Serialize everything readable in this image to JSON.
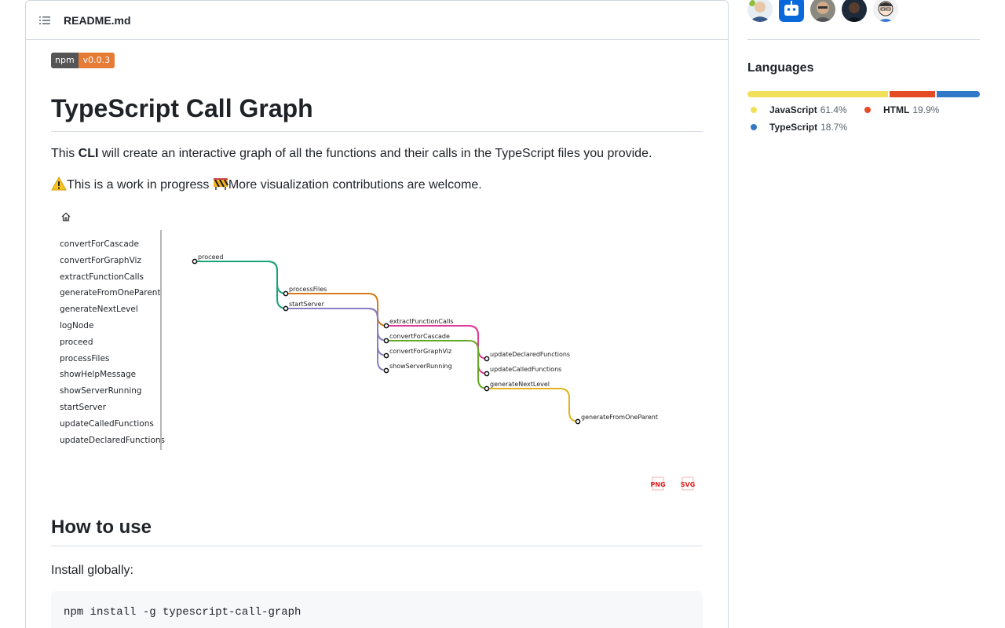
{
  "readme": {
    "filename": "README.md",
    "badge": {
      "label": "npm",
      "version": "v0.0.3",
      "label_color": "#555555",
      "version_color": "#e57b35"
    },
    "title": "TypeScript Call Graph",
    "intro": {
      "before": "This ",
      "bold": "CLI",
      "after": " will create an interactive graph of all the functions and their calls in the TypeScript files you provide."
    },
    "wip": {
      "text1": "This is a work in progress ",
      "text2": "More visualization contributions are welcome."
    },
    "graph": {
      "functions": [
        "convertForCascade",
        "convertForGraphViz",
        "extractFunctionCalls",
        "generateFromOneParent",
        "generateNextLevel",
        "logNode",
        "proceed",
        "processFiles",
        "showHelpMessage",
        "showServerRunning",
        "startServer",
        "updateCalledFunctions",
        "updateDeclaredFunctions"
      ],
      "nodes": [
        "proceed",
        "processFiles",
        "startServer",
        "extractFunctionCalls",
        "convertForCascade",
        "convertForGraphViz",
        "showServerRunning",
        "updateDeclaredFunctions",
        "updateCalledFunctions",
        "generateNextLevel",
        "generateFromOneParent"
      ],
      "edges": [
        {
          "from": "proceed",
          "to": "processFiles",
          "color": "#1aa37a"
        },
        {
          "from": "proceed",
          "to": "startServer",
          "color": "#1aa37a"
        },
        {
          "from": "processFiles",
          "to": "extractFunctionCalls",
          "color": "#d97a16"
        },
        {
          "from": "startServer",
          "to": "convertForCascade",
          "color": "#8a7fc0"
        },
        {
          "from": "startServer",
          "to": "convertForGraphViz",
          "color": "#8a7fc0"
        },
        {
          "from": "startServer",
          "to": "showServerRunning",
          "color": "#8a7fc0"
        },
        {
          "from": "extractFunctionCalls",
          "to": "updateDeclaredFunctions",
          "color": "#e0399a"
        },
        {
          "from": "extractFunctionCalls",
          "to": "updateCalledFunctions",
          "color": "#e0399a"
        },
        {
          "from": "convertForCascade",
          "to": "generateNextLevel",
          "color": "#62aa25"
        },
        {
          "from": "generateNextLevel",
          "to": "generateFromOneParent",
          "color": "#e3b21a"
        }
      ],
      "exports": [
        "PNG",
        "SVG"
      ]
    },
    "how_to_use": "How to use",
    "install_text": "Install globally:",
    "install_cmd": "npm install -g typescript-call-graph"
  },
  "sidebar": {
    "languages_title": "Languages",
    "languages": [
      {
        "name": "JavaScript",
        "percent": "61.4%",
        "value": 61.4,
        "color": "#f1e05a"
      },
      {
        "name": "HTML",
        "percent": "19.9%",
        "value": 19.9,
        "color": "#e34c26"
      },
      {
        "name": "TypeScript",
        "percent": "18.7%",
        "value": 18.7,
        "color": "#3178c6"
      }
    ]
  }
}
